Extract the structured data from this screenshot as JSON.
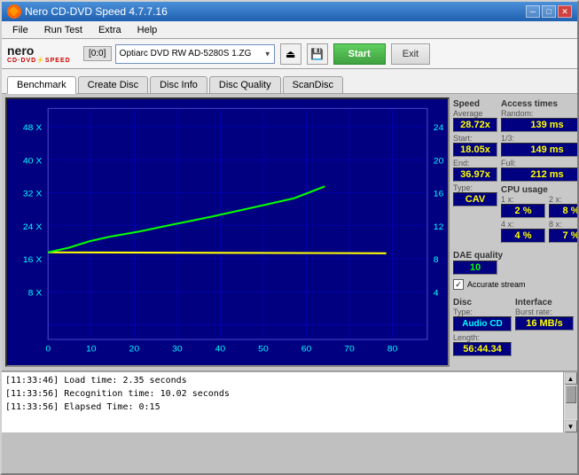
{
  "window": {
    "title": "Nero CD-DVD Speed 4.7.7.16",
    "icon": "🔶"
  },
  "titlebar": {
    "minimize": "─",
    "maximize": "□",
    "close": "✕"
  },
  "menu": {
    "items": [
      "File",
      "Run Test",
      "Extra",
      "Help"
    ]
  },
  "toolbar": {
    "logo_top": "nero",
    "logo_bottom": "CD·DVD⚡SPEED",
    "drive_label": "[0:0]",
    "drive_value": "Optiarc DVD RW AD-5280S 1.ZG",
    "start_label": "Start",
    "exit_label": "Exit"
  },
  "tabs": [
    {
      "label": "Benchmark",
      "active": true
    },
    {
      "label": "Create Disc",
      "active": false
    },
    {
      "label": "Disc Info",
      "active": false
    },
    {
      "label": "Disc Quality",
      "active": false
    },
    {
      "label": "ScanDisc",
      "active": false
    }
  ],
  "stats": {
    "speed_label": "Speed",
    "average_label": "Average",
    "average_value": "28.72x",
    "start_label": "Start:",
    "start_value": "18.05x",
    "end_label": "End:",
    "end_value": "36.97x",
    "type_label": "Type:",
    "type_value": "CAV",
    "access_times_label": "Access times",
    "random_label": "Random:",
    "random_value": "139 ms",
    "one_third_label": "1/3:",
    "one_third_value": "149 ms",
    "full_label": "Full:",
    "full_value": "212 ms",
    "cpu_label": "CPU usage",
    "cpu_1x_label": "1 x:",
    "cpu_1x_value": "2 %",
    "cpu_2x_label": "2 x:",
    "cpu_2x_value": "8 %",
    "cpu_4x_label": "4 x:",
    "cpu_4x_value": "4 %",
    "cpu_8x_label": "8 x:",
    "cpu_8x_value": "7 %",
    "dae_quality_label": "DAE quality",
    "dae_quality_value": "10",
    "accurate_stream_label": "Accurate stream",
    "accurate_stream_checked": "✓",
    "disc_label": "Disc",
    "disc_type_label": "Type:",
    "disc_type_value": "Audio CD",
    "disc_length_label": "Length:",
    "disc_length_value": "56:44.34",
    "interface_label": "Interface",
    "burst_rate_label": "Burst rate:",
    "burst_rate_value": "16 MB/s"
  },
  "log": {
    "lines": [
      "[11:33:46]  Load time: 2.35 seconds",
      "[11:33:56]  Recognition time: 10.02 seconds",
      "[11:33:56]  Elapsed Time: 0:15"
    ]
  },
  "chart": {
    "left_axis": [
      "48 X",
      "40 X",
      "32 X",
      "24 X",
      "16 X",
      "8 X"
    ],
    "right_axis": [
      "24",
      "20",
      "16",
      "12",
      "8",
      "4"
    ],
    "bottom_axis": [
      "0",
      "10",
      "20",
      "30",
      "40",
      "50",
      "60",
      "70",
      "80"
    ]
  }
}
